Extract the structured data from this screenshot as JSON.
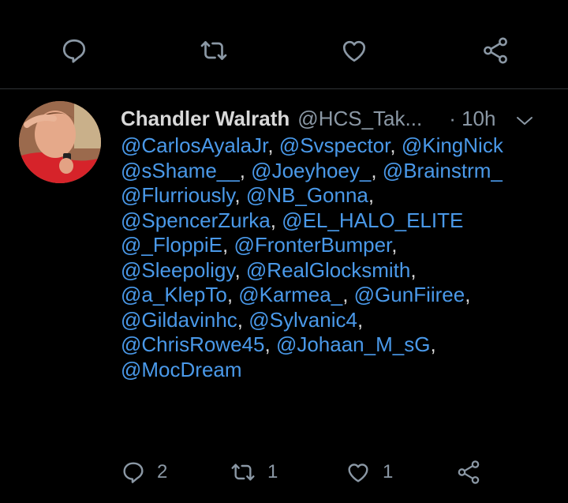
{
  "tweet": {
    "display_name": "Chandler Walrath",
    "handle": "@HCS_Tak...",
    "time": "· 10h",
    "mentions": [
      "@CarlosAyalaJr",
      "@Svspector",
      "@KingNick",
      "@sShame__",
      "@Joeyhoey_",
      "@Brainstrm_",
      "@Flurriously",
      "@NB_Gonna",
      "@SpencerZurka",
      "@EL_HALO_ELITE",
      "@_FloppiE",
      "@FronterBumper",
      "@Sleepoligy",
      "@RealGlocksmith",
      "@a_KlepTo",
      "@Karmea_",
      "@GunFiiree",
      "@Gildavinhc",
      "@Sylvanic4",
      "@ChrisRowe45",
      "@Johaan_M_sG",
      "@MocDream"
    ],
    "separators": [
      ",",
      ","
    ],
    "counts": {
      "replies": "2",
      "retweets": "1",
      "likes": "1"
    }
  },
  "top_actions": {
    "icons": [
      "reply-icon",
      "retweet-icon",
      "like-icon",
      "share-icon"
    ]
  },
  "colors": {
    "background": "#000000",
    "text": "#d9d9d9",
    "muted": "#8b98a5",
    "mention": "#4a99e9",
    "divider": "#2f3336"
  }
}
